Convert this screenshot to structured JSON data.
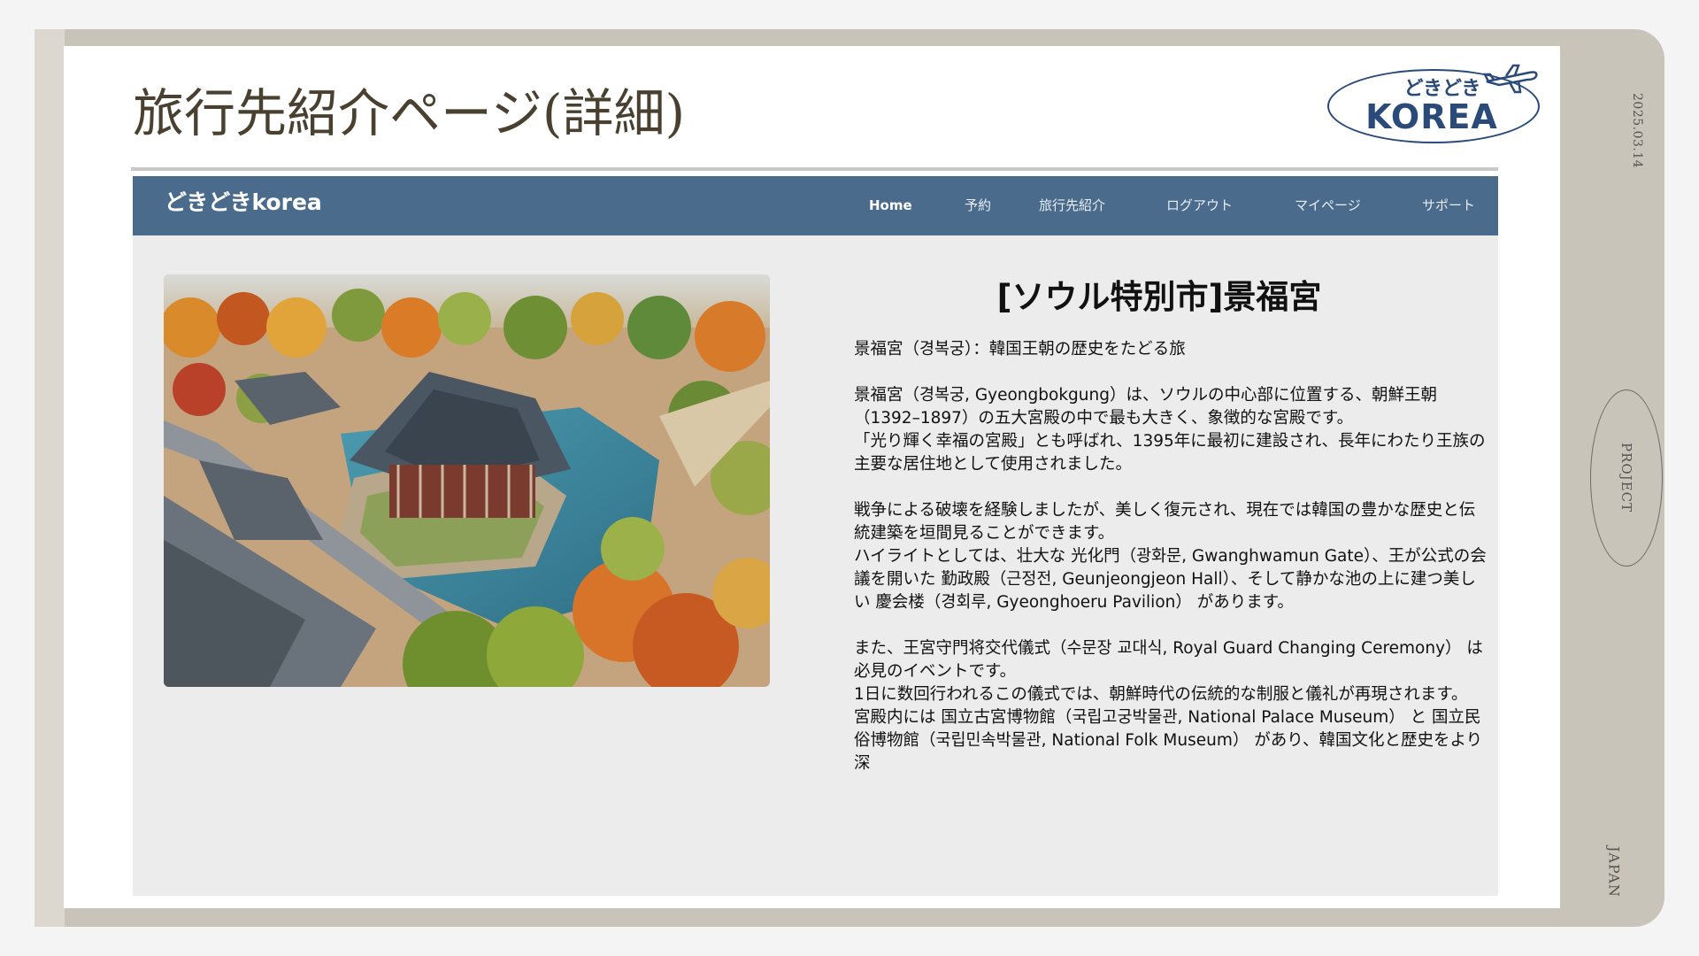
{
  "slide": {
    "title": "旅行先紹介ページ(詳細)",
    "date": "2025.03.14",
    "project_label": "PROJECT",
    "country_label": "JAPAN"
  },
  "logo": {
    "top_text": "どきどき",
    "main_text": "KOREA",
    "icon": "airplane-icon"
  },
  "site": {
    "brand": "どきどきkorea",
    "nav": [
      "Home",
      "予約",
      "旅行先紹介",
      "ログアウト",
      "マイページ",
      "サポート"
    ],
    "photo_alt": "Gyeongbokgung palace aerial view",
    "heading": "[ソウル特別市]景福宮",
    "paragraphs": [
      "景福宮（경복궁）：韓国王朝の歴史をたどる旅",
      "景福宮（경복궁, Gyeongbokgung）は、ソウルの中心部に位置する、朝鮮王朝（1392–1897）の五大宮殿の中で最も大きく、象徴的な宮殿です。\n「光り輝く幸福の宮殿」とも呼ばれ、1395年に最初に建設され、長年にわたり王族の主要な居住地として使用されました。",
      "戦争による破壊を経験しましたが、美しく復元され、現在では韓国の豊かな歴史と伝統建築を垣間見ることができます。\nハイライトとしては、壮大な 光化門（광화문, Gwanghwamun Gate）、王が公式の会議を開いた 勤政殿（근정전, Geunjeongjeon Hall）、そして静かな池の上に建つ美しい 慶会楼（경회루, Gyeonghoeru Pavilion） があります。",
      "また、王宮守門将交代儀式（수문장 교대식, Royal Guard Changing Ceremony） は必見のイベントです。\n1日に数回行われるこの儀式では、朝鮮時代の伝統的な制服と儀礼が再現されます。\n宮殿内には 国立古宮博物館（국립고궁박물관, National Palace Museum） と 国立民俗博物館（국립민속박물관, National Folk Museum） があり、韓国文化と歴史をより深"
    ]
  },
  "colors": {
    "nav_bg": "#4b6b8c",
    "frame": "#c9c4b9",
    "title_text": "#4a4030",
    "logo_blue": "#2a4a7a",
    "site_bg": "#ececec"
  }
}
